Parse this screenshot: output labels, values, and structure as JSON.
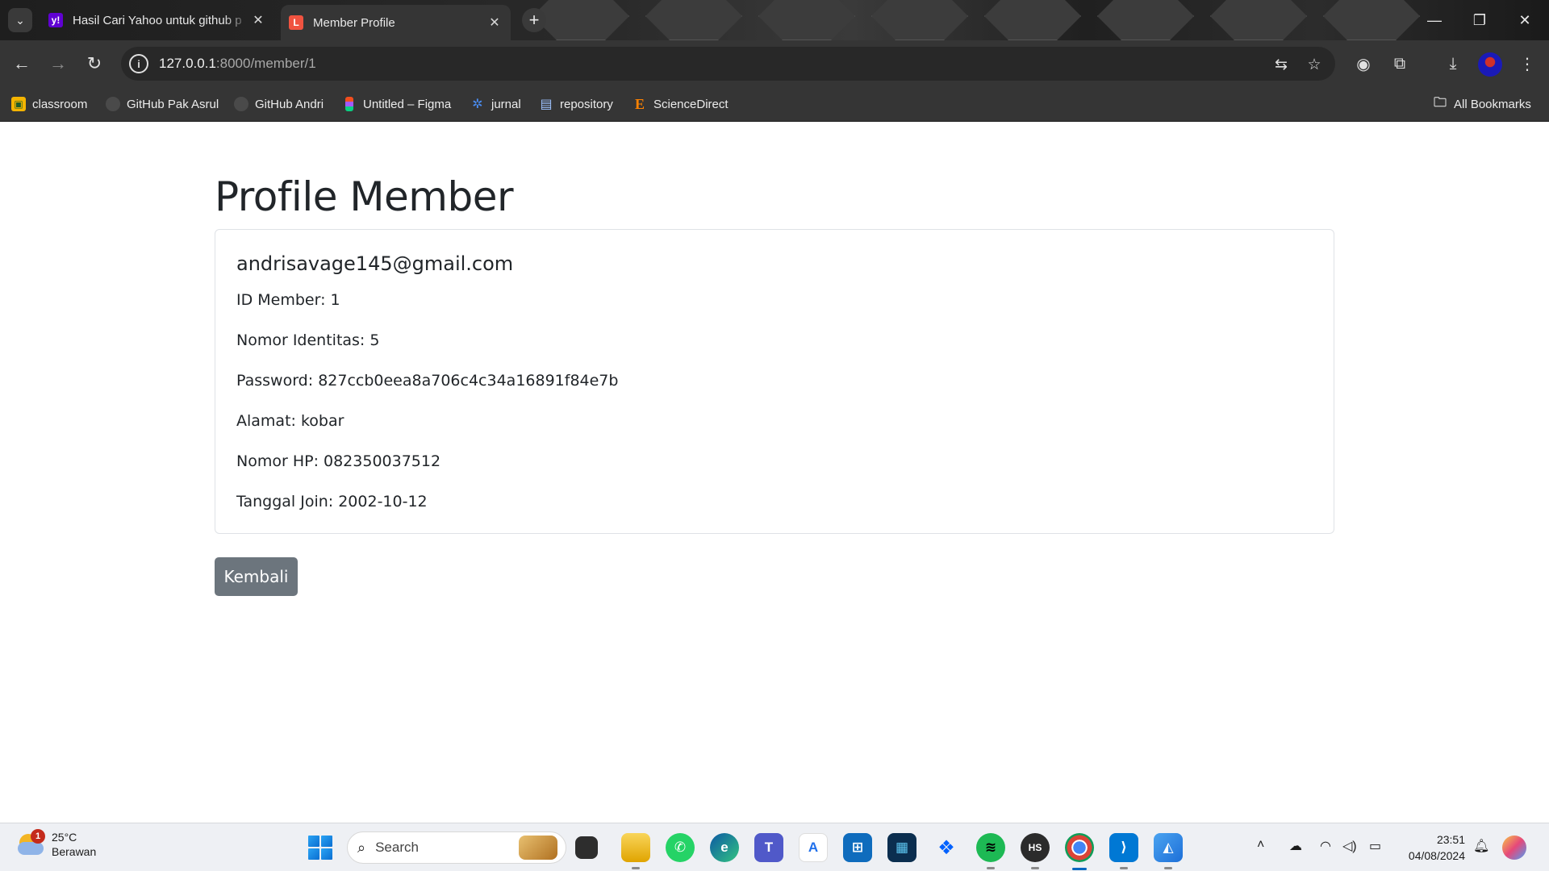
{
  "browser": {
    "tabs": [
      {
        "title": "Hasil Cari Yahoo untuk github p",
        "favicon_icon": "yahoo-icon",
        "close": "✕"
      },
      {
        "title": "Member Profile",
        "favicon_icon": "laravel-icon",
        "close": "✕"
      }
    ],
    "new_tab": "+",
    "url_host": "127.0.0.1",
    "url_path": ":8000/member/1",
    "bookmarks": [
      {
        "label": "classroom",
        "icon": "classroom-icon"
      },
      {
        "label": "GitHub Pak Asrul",
        "icon": "github-icon"
      },
      {
        "label": "GitHub Andri",
        "icon": "github-icon"
      },
      {
        "label": "Untitled – Figma",
        "icon": "figma-icon"
      },
      {
        "label": "jurnal",
        "icon": "network-icon"
      },
      {
        "label": "repository",
        "icon": "document-icon"
      },
      {
        "label": "ScienceDirect",
        "icon": "elsevier-icon"
      }
    ],
    "all_bookmarks": "All Bookmarks"
  },
  "page": {
    "heading": "Profile Member",
    "email": "andrisavage145@gmail.com",
    "fields": [
      "ID Member: 1",
      "Nomor Identitas: 5",
      "Password: 827ccb0eea8a706c4c34a16891f84e7b",
      "Alamat: kobar",
      "Nomor HP: 082350037512",
      "Tanggal Join: 2002-10-12"
    ],
    "back_button": "Kembali"
  },
  "taskbar": {
    "weather_temp": "25°C",
    "weather_desc": "Berawan",
    "weather_badge": "1",
    "search_placeholder": "Search",
    "time": "23:51",
    "date": "04/08/2024"
  },
  "colors": {
    "button_secondary": "#6c757d",
    "text": "#212529",
    "card_border": "#dfe2e6",
    "browser_chrome": "#353535"
  }
}
